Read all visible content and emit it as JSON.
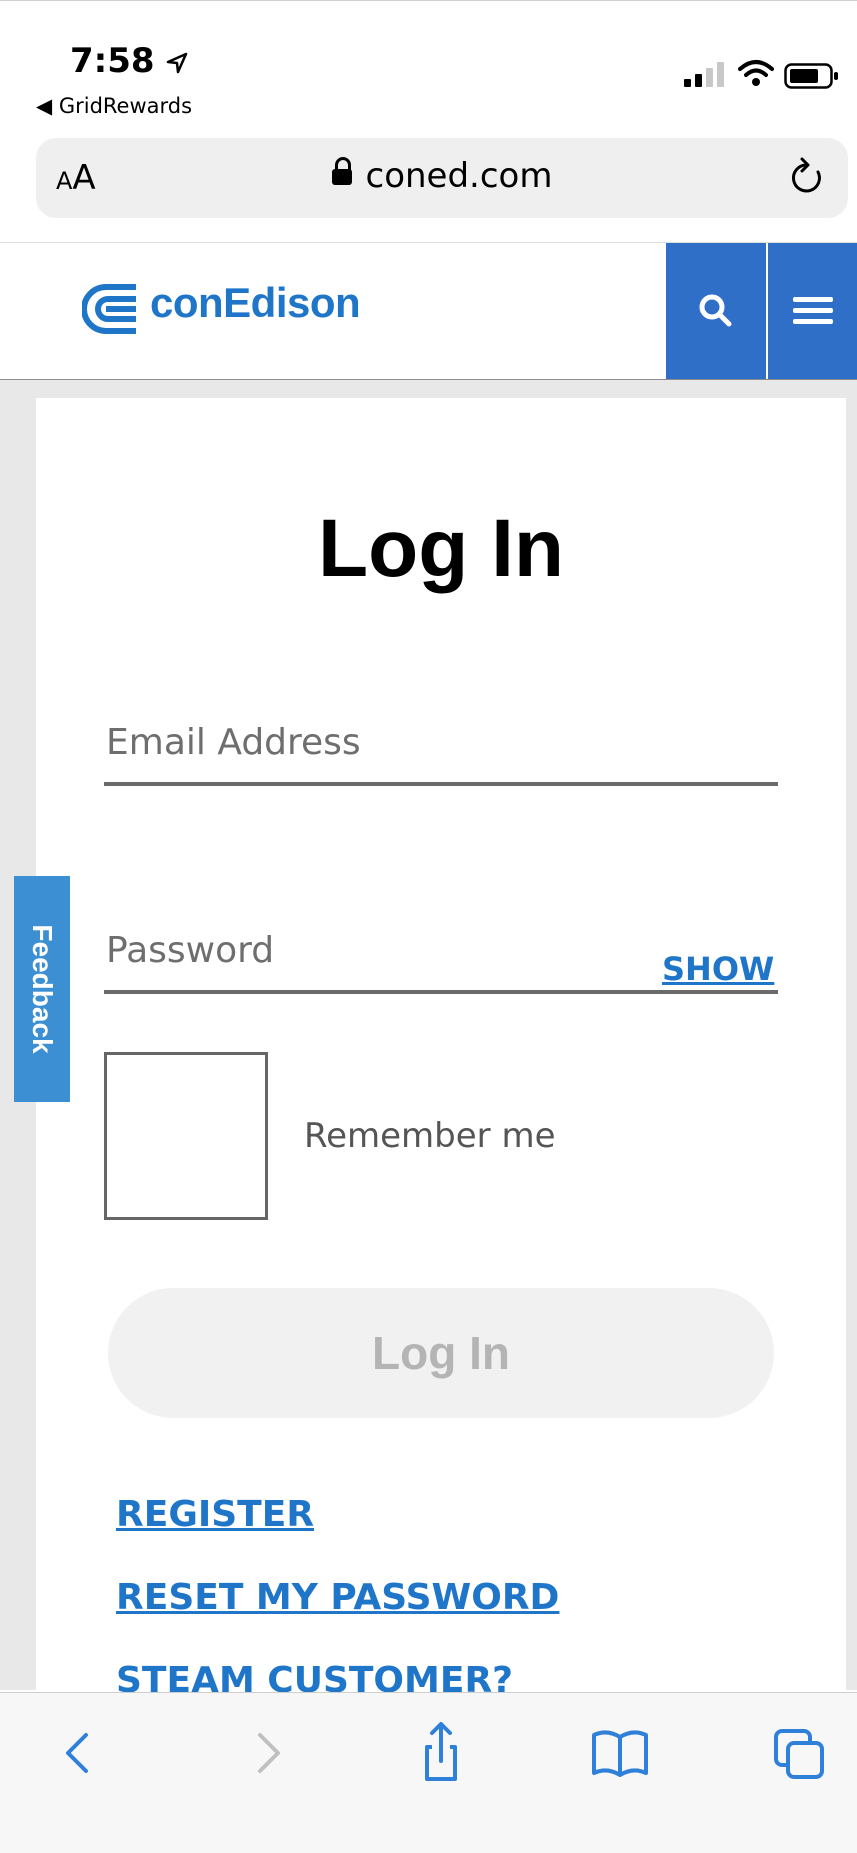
{
  "status_bar": {
    "time": "7:58",
    "back_app": "◀ GridRewards"
  },
  "browser": {
    "aa_label_small": "A",
    "aa_label": "A",
    "url": "coned.com"
  },
  "header": {
    "brand": "conEdison",
    "brand_color": "#1f76c9",
    "nav_color": "#2f6fc8"
  },
  "form": {
    "title": "Log In",
    "email_placeholder": "Email Address",
    "password_placeholder": "Password",
    "show_label": "SHOW",
    "remember_label": "Remember me",
    "login_label": "Log In"
  },
  "links": {
    "register": "REGISTER",
    "reset": "RESET MY PASSWORD",
    "steam": "STEAM CUSTOMER?"
  },
  "feedback": {
    "label": "Feedback"
  },
  "icons": [
    "location-arrow-icon",
    "signal-icon",
    "wifi-icon",
    "battery-icon",
    "lock-icon",
    "reload-icon",
    "search-icon",
    "hamburger-menu-icon",
    "back-icon",
    "forward-icon",
    "share-icon",
    "bookmarks-icon",
    "tabs-icon"
  ]
}
